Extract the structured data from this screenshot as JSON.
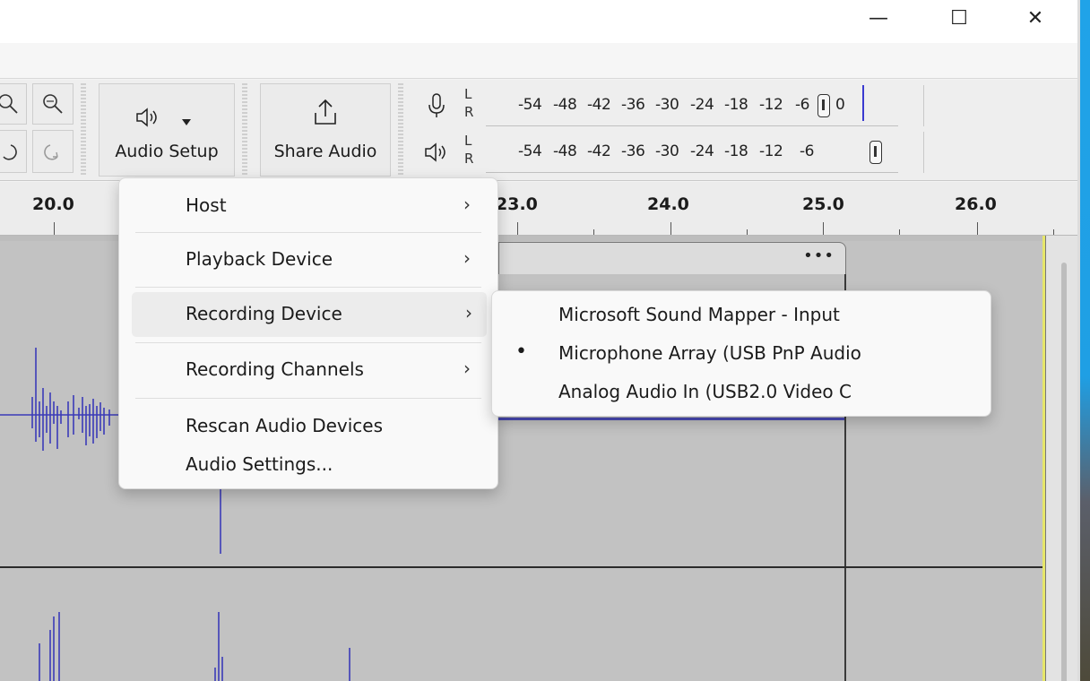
{
  "window": {
    "minimize": "—",
    "maximize": "☐",
    "close": "✕"
  },
  "toolbar": {
    "audio_setup_label": "Audio Setup",
    "share_audio_label": "Share Audio",
    "recording_meter": {
      "channel_l": "L",
      "channel_r": "R",
      "ticks": [
        "-54",
        "-48",
        "-42",
        "-36",
        "-30",
        "-24",
        "-18",
        "-12",
        "-6",
        "0"
      ]
    },
    "playback_meter": {
      "channel_l": "L",
      "channel_r": "R",
      "ticks": [
        "-54",
        "-48",
        "-42",
        "-36",
        "-30",
        "-24",
        "-18",
        "-12",
        "-6"
      ]
    }
  },
  "timeline": {
    "labels": [
      "20.0",
      "23.0",
      "24.0",
      "25.0",
      "26.0"
    ]
  },
  "clip": {
    "menu_dots": "•••"
  },
  "audio_setup_menu": {
    "items": [
      {
        "label": "Host",
        "chevron": "›"
      },
      {
        "label": "Playback Device",
        "chevron": "›"
      },
      {
        "label": "Recording Device",
        "chevron": "›"
      },
      {
        "label": "Recording Channels",
        "chevron": "›"
      },
      {
        "label": "Rescan Audio Devices"
      },
      {
        "label": "Audio Settings..."
      }
    ]
  },
  "recording_device_submenu": {
    "items": [
      {
        "label": "Microsoft Sound Mapper - Input",
        "selected": false
      },
      {
        "label": "Microphone Array (USB PnP Audio",
        "selected": true,
        "bullet": "•"
      },
      {
        "label": "Analog Audio In (USB2.0 Video C",
        "selected": false
      }
    ]
  },
  "colors": {
    "waveform": "#3b3bb8",
    "track_bg": "#c2c2c2",
    "accent_selection": "#4a4ab8"
  },
  "icons": [
    "minimize-icon",
    "maximize-icon",
    "close-icon",
    "zoom-in-icon",
    "zoom-fit-icon",
    "undo-icon",
    "redo-icon",
    "speaker-icon",
    "dropdown-caret-icon",
    "share-icon",
    "microphone-icon",
    "chevron-right-icon"
  ]
}
